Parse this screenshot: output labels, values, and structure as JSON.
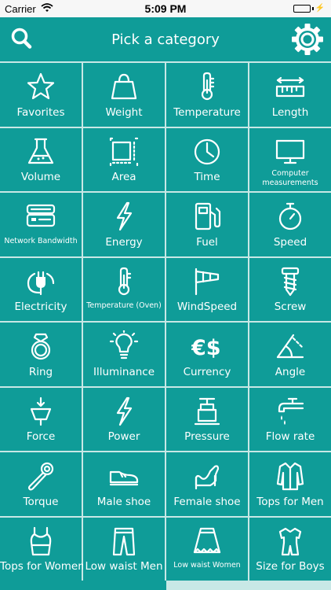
{
  "status_bar": {
    "carrier": "Carrier",
    "time": "5:09 PM"
  },
  "nav": {
    "title": "Pick a category"
  },
  "categories": [
    {
      "label": "Favorites",
      "icon": "star-icon"
    },
    {
      "label": "Weight",
      "icon": "weight-icon"
    },
    {
      "label": "Temperature",
      "icon": "thermometer-icon"
    },
    {
      "label": "Length",
      "icon": "ruler-icon"
    },
    {
      "label": "Volume",
      "icon": "flask-icon"
    },
    {
      "label": "Area",
      "icon": "area-icon"
    },
    {
      "label": "Time",
      "icon": "clock-icon"
    },
    {
      "label": "Computer measurements",
      "icon": "monitor-icon"
    },
    {
      "label": "Network Bandwidth",
      "icon": "router-icon"
    },
    {
      "label": "Energy",
      "icon": "lightning-icon"
    },
    {
      "label": "Fuel",
      "icon": "fuel-pump-icon"
    },
    {
      "label": "Speed",
      "icon": "stopwatch-icon"
    },
    {
      "label": "Electricity",
      "icon": "plug-icon"
    },
    {
      "label": "Temperature (Oven)",
      "icon": "oven-thermometer-icon"
    },
    {
      "label": "WindSpeed",
      "icon": "windsock-icon"
    },
    {
      "label": "Screw",
      "icon": "screw-icon"
    },
    {
      "label": "Ring",
      "icon": "ring-icon"
    },
    {
      "label": "Illuminance",
      "icon": "bulb-icon"
    },
    {
      "label": "Currency",
      "icon": "currency-icon"
    },
    {
      "label": "Angle",
      "icon": "angle-icon"
    },
    {
      "label": "Force",
      "icon": "force-icon"
    },
    {
      "label": "Power",
      "icon": "power-bolt-icon"
    },
    {
      "label": "Pressure",
      "icon": "pressure-gauge-icon"
    },
    {
      "label": "Flow rate",
      "icon": "faucet-icon"
    },
    {
      "label": "Torque",
      "icon": "wrench-icon"
    },
    {
      "label": "Male shoe",
      "icon": "male-shoe-icon"
    },
    {
      "label": "Female shoe",
      "icon": "high-heel-icon"
    },
    {
      "label": "Tops for Men",
      "icon": "shirt-icon"
    },
    {
      "label": "Tops for Women",
      "icon": "tank-top-icon"
    },
    {
      "label": "Low waist Men",
      "icon": "pants-icon"
    },
    {
      "label": "Low waist Women",
      "icon": "skirt-icon"
    },
    {
      "label": "Size for Boys",
      "icon": "boy-clothes-icon"
    }
  ]
}
